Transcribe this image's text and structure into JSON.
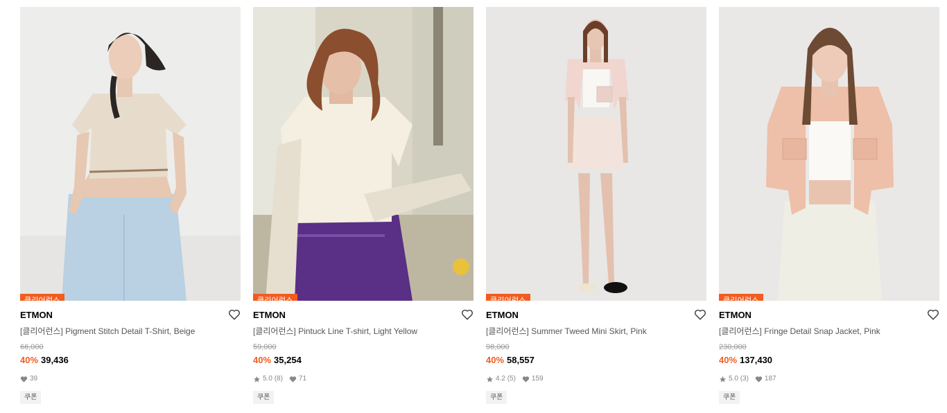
{
  "products": [
    {
      "badge": "클리어런스",
      "brand": "ETMON",
      "name": "[클리어런스] Pigment Stitch Detail T-Shirt, Beige",
      "original_price": "66,000",
      "discount": "40%",
      "sale_price": "39,436",
      "rating": "",
      "reviews": "",
      "likes": "39",
      "coupon": "쿠폰"
    },
    {
      "badge": "클리어런스",
      "brand": "ETMON",
      "name": "[클리어런스] Pintuck Line T-shirt, Light Yellow",
      "original_price": "59,000",
      "discount": "40%",
      "sale_price": "35,254",
      "rating": "5.0",
      "reviews": "(8)",
      "likes": "71",
      "coupon": "쿠폰"
    },
    {
      "badge": "클리어런스",
      "brand": "ETMON",
      "name": "[클리어런스] Summer Tweed Mini Skirt, Pink",
      "original_price": "98,000",
      "discount": "40%",
      "sale_price": "58,557",
      "rating": "4.2",
      "reviews": "(5)",
      "likes": "159",
      "coupon": "쿠폰"
    },
    {
      "badge": "클리어런스",
      "brand": "ETMON",
      "name": "[클리어런스] Fringe Detail Snap Jacket, Pink",
      "original_price": "230,000",
      "discount": "40%",
      "sale_price": "137,430",
      "rating": "5.0",
      "reviews": "(3)",
      "likes": "187",
      "coupon": "쿠폰"
    }
  ],
  "icons": {
    "wishlist": "heart-outline-icon",
    "rating": "star-icon",
    "likes": "heart-filled-icon"
  },
  "colors": {
    "accent": "#f25c1f",
    "muted_text": "#888888"
  }
}
